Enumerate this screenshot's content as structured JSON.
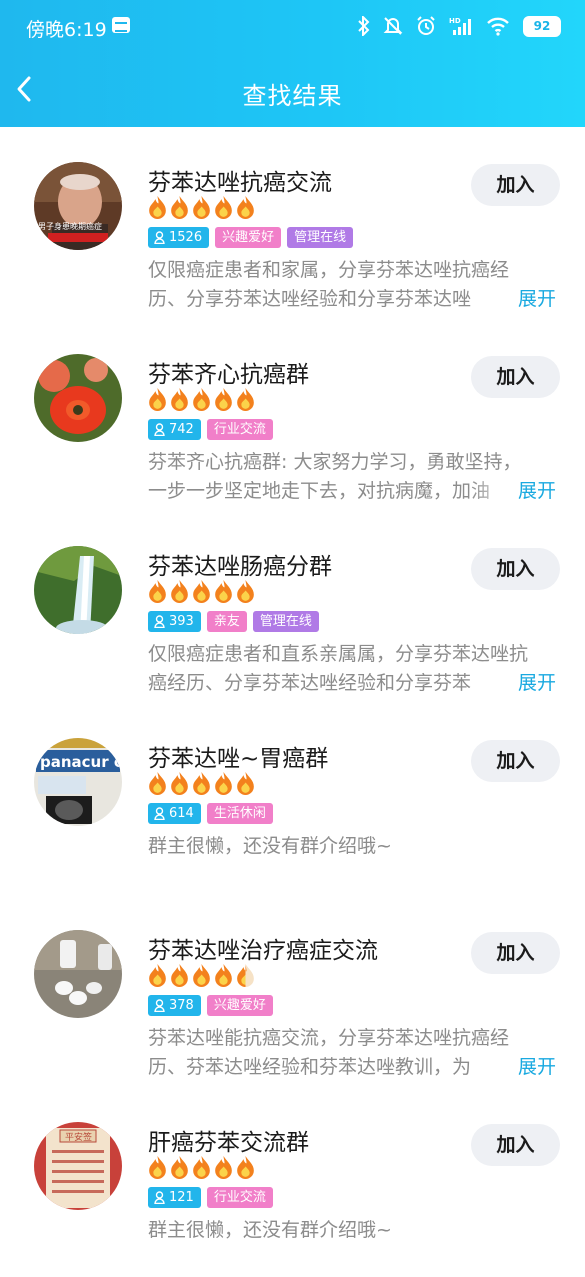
{
  "status_bar": {
    "time": "傍晚6:19",
    "battery": "92"
  },
  "header": {
    "title": "查找结果"
  },
  "groups": [
    {
      "name": "芬苯达唑抗癌交流",
      "flames": 5,
      "members": "1526",
      "tags": [
        "兴趣爱好",
        "管理在线"
      ],
      "description": "仅限癌症患者和家属，分享芬苯达唑抗癌经历、分享芬苯达唑经验和分享芬苯达唑",
      "expand_label": "展开",
      "join_label": "加入"
    },
    {
      "name": "芬苯齐心抗癌群",
      "flames": 5,
      "members": "742",
      "tags": [
        "行业交流"
      ],
      "description": "芬苯齐心抗癌群: 大家努力学习，勇敢坚持，一步一步坚定地走下去，对抗病魔，加油",
      "expand_label": "展开",
      "join_label": "加入"
    },
    {
      "name": "芬苯达唑肠癌分群",
      "flames": 5,
      "members": "393",
      "tags": [
        "亲友",
        "管理在线"
      ],
      "description": "仅限癌症患者和直系亲属属，分享芬苯达唑抗癌经历、分享芬苯达唑经验和分享芬苯",
      "expand_label": "展开",
      "join_label": "加入"
    },
    {
      "name": "芬苯达唑~胃癌群",
      "flames": 5,
      "members": "614",
      "tags": [
        "生活休闲"
      ],
      "description": "群主很懒，还没有群介绍哦~",
      "expand_label": "",
      "join_label": "加入"
    },
    {
      "name": "芬苯达唑治疗癌症交流",
      "flames": 4.5,
      "members": "378",
      "tags": [
        "兴趣爱好"
      ],
      "description": "芬苯达唑能抗癌交流，分享芬苯达唑抗癌经历、芬苯达唑经验和芬苯达唑教训，为",
      "expand_label": "展开",
      "join_label": "加入"
    },
    {
      "name": "肝癌芬苯交流群",
      "flames": 5,
      "members": "121",
      "tags": [
        "行业交流"
      ],
      "description": "群主很懒，还没有群介绍哦~",
      "expand_label": "",
      "join_label": "加入"
    }
  ],
  "avatar_texts": {
    "g1": "男子身患晚期癌症",
    "g4": "panacur c",
    "g6": "平安签"
  },
  "colors": {
    "header": "#1fb8ee",
    "member_tag": "#22b5eb",
    "pink_tag": "#f17fc9",
    "purple_tag": "#b07ae6",
    "expand": "#19a9e0"
  }
}
